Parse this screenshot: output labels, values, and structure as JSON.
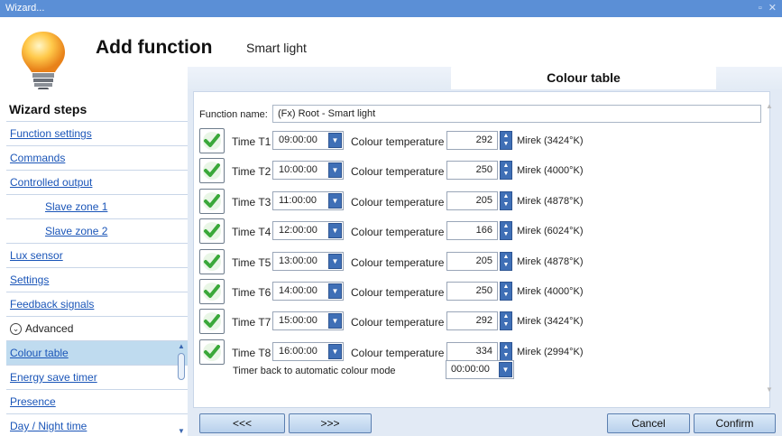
{
  "window": {
    "title": "Wizard..."
  },
  "header": {
    "title": "Add function",
    "subtitle": "Smart light",
    "tab": "Colour table"
  },
  "sidebar": {
    "heading": "Wizard steps",
    "items": [
      {
        "label": "Function settings"
      },
      {
        "label": "Commands"
      },
      {
        "label": "Controlled output"
      },
      {
        "label": "Slave zone 1"
      },
      {
        "label": "Slave zone 2"
      },
      {
        "label": "Lux sensor"
      },
      {
        "label": "Settings"
      },
      {
        "label": "Feedback signals"
      },
      {
        "label": "Advanced"
      },
      {
        "label": "Colour table"
      },
      {
        "label": "Energy save timer"
      },
      {
        "label": "Presence"
      },
      {
        "label": "Day / Night time"
      }
    ]
  },
  "form": {
    "function_name_label": "Function name:",
    "function_name_value": "(Fx) Root - Smart light",
    "colour_temp_label": "Colour temperature",
    "rows": [
      {
        "label": "Time T1",
        "time": "09:00:00",
        "value": "292",
        "unit": "Mirek (3424°K)",
        "checked": true
      },
      {
        "label": "Time T2",
        "time": "10:00:00",
        "value": "250",
        "unit": "Mirek (4000°K)",
        "checked": true
      },
      {
        "label": "Time T3",
        "time": "11:00:00",
        "value": "205",
        "unit": "Mirek (4878°K)",
        "checked": true
      },
      {
        "label": "Time T4",
        "time": "12:00:00",
        "value": "166",
        "unit": "Mirek (6024°K)",
        "checked": true
      },
      {
        "label": "Time T5",
        "time": "13:00:00",
        "value": "205",
        "unit": "Mirek (4878°K)",
        "checked": true
      },
      {
        "label": "Time T6",
        "time": "14:00:00",
        "value": "250",
        "unit": "Mirek (4000°K)",
        "checked": true
      },
      {
        "label": "Time T7",
        "time": "15:00:00",
        "value": "292",
        "unit": "Mirek (3424°K)",
        "checked": true
      },
      {
        "label": "Time T8",
        "time": "16:00:00",
        "value": "334",
        "unit": "Mirek (2994°K)",
        "checked": true
      }
    ],
    "auto_mode_label": "Timer back to automatic colour mode",
    "auto_mode_value": "00:00:00"
  },
  "footer": {
    "prev": "<<<",
    "next": ">>>",
    "cancel": "Cancel",
    "confirm": "Confirm"
  },
  "colors": {
    "accent": "#3f6fb6",
    "titlebar": "#5b8fd6",
    "check": "#3aa83a",
    "link": "#1a55b8"
  }
}
